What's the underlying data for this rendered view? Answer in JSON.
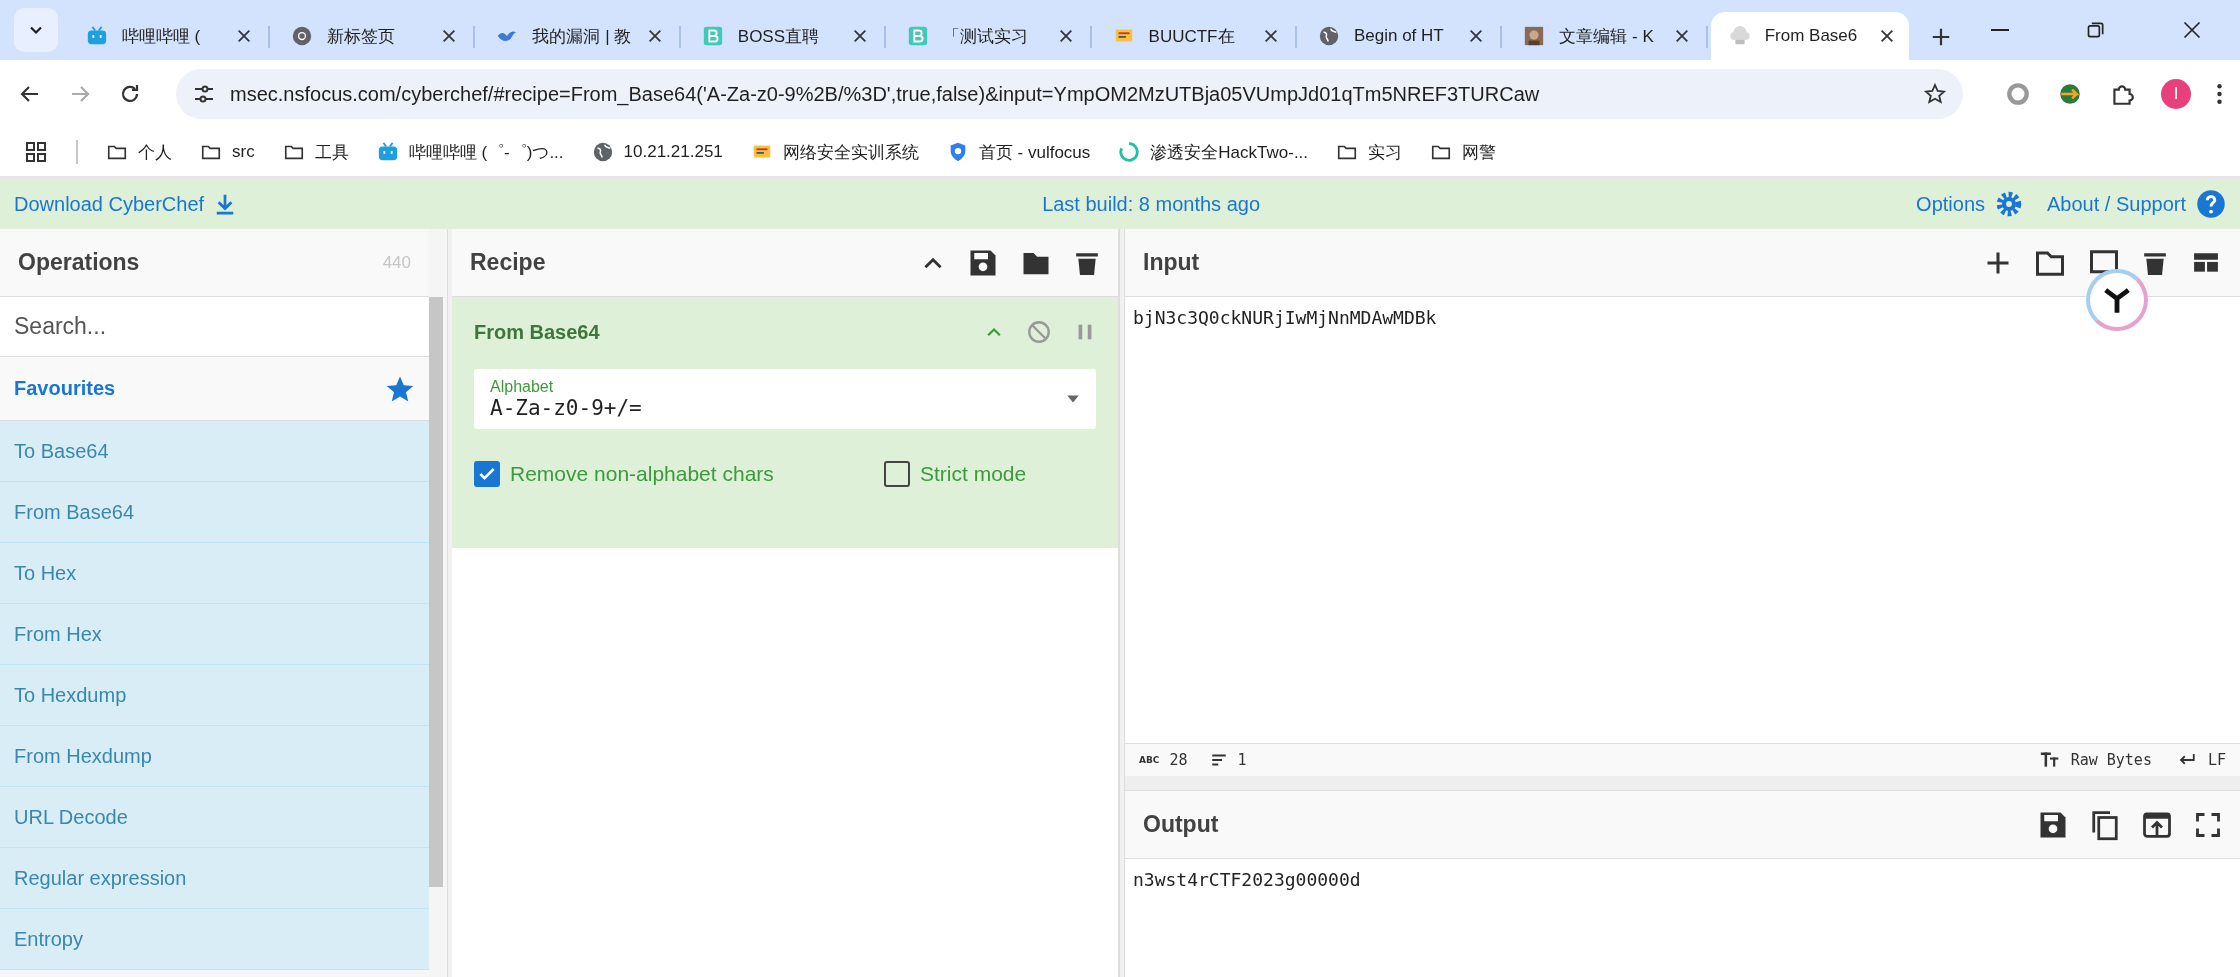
{
  "browser": {
    "tabs": [
      {
        "title": "哔哩哔哩 (",
        "kind": "tv",
        "selected": false
      },
      {
        "title": "新标签页",
        "kind": "chrome",
        "selected": false
      },
      {
        "title": "我的漏洞 | 教",
        "kind": "bird",
        "selected": false
      },
      {
        "title": "BOSS直聘",
        "kind": "b",
        "selected": false
      },
      {
        "title": "「测试实习",
        "kind": "b",
        "selected": false
      },
      {
        "title": "BUUCTF在",
        "kind": "flag",
        "selected": false
      },
      {
        "title": "Begin of HT",
        "kind": "globe",
        "selected": false
      },
      {
        "title": "文章编辑 - K",
        "kind": "photo",
        "selected": false
      },
      {
        "title": "From Base6",
        "kind": "chef",
        "selected": true
      }
    ],
    "url": "msec.nsfocus.com/cyberchef/#recipe=From_Base64('A-Za-z0-9%2B/%3D',true,false)&input=YmpOM2MzUTBja05VUmpJd01qTm5NREF3TURCaw",
    "profile_initial": "I",
    "bookmarks": [
      {
        "label": "个人",
        "kind": "folder"
      },
      {
        "label": "src",
        "kind": "folder"
      },
      {
        "label": "工具",
        "kind": "folder"
      },
      {
        "label": "哔哩哔哩 (゜-゜)つ...",
        "kind": "tv"
      },
      {
        "label": "10.21.21.251",
        "kind": "globe"
      },
      {
        "label": "网络安全实训系统",
        "kind": "flag"
      },
      {
        "label": "首页 - vulfocus",
        "kind": "shield"
      },
      {
        "label": "渗透安全HackTwo-...",
        "kind": "ring"
      },
      {
        "label": "实习",
        "kind": "folder"
      },
      {
        "label": "网警",
        "kind": "folder"
      }
    ]
  },
  "banner": {
    "download": "Download CyberChef",
    "build": "Last build: 8 months ago",
    "options": "Options",
    "about": "About / Support"
  },
  "operations": {
    "title": "Operations",
    "count": "440",
    "search_placeholder": "Search...",
    "favourites": "Favourites",
    "items": [
      "To Base64",
      "From Base64",
      "To Hex",
      "From Hex",
      "To Hexdump",
      "From Hexdump",
      "URL Decode",
      "Regular expression",
      "Entropy"
    ]
  },
  "recipe": {
    "title": "Recipe",
    "operation": {
      "name": "From Base64",
      "alphabet_label": "Alphabet",
      "alphabet": "A-Za-z0-9+/=",
      "options": [
        {
          "label": "Remove non-alphabet chars",
          "checked": true
        },
        {
          "label": "Strict mode",
          "checked": false
        }
      ]
    }
  },
  "input": {
    "title": "Input",
    "value": "bjN3c3Q0ckNURjIwMjNnMDAwMDBk"
  },
  "status_bar": {
    "chars_label": "ABC",
    "chars": "28",
    "lines": "1",
    "encoding": "Raw Bytes",
    "eol": "LF"
  },
  "output": {
    "title": "Output",
    "value": "n3wst4rCTF2023g00000d"
  }
}
